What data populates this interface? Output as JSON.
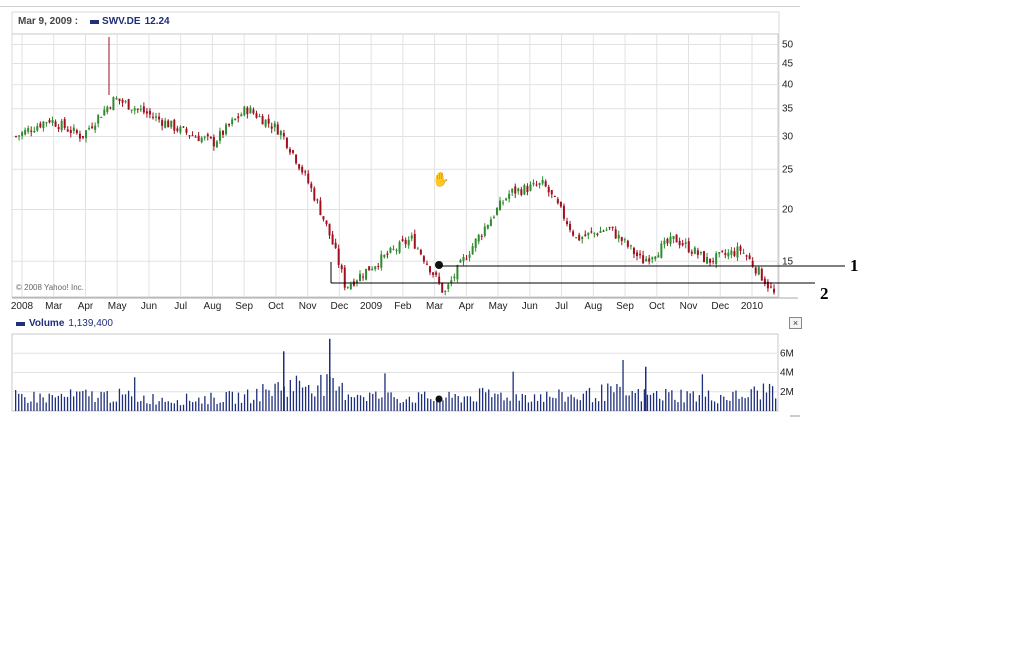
{
  "header": {
    "date": "Mar 9, 2009 :",
    "ticker": "SWV.DE",
    "price": "12.24"
  },
  "copyright": "© 2008 Yahoo! Inc.",
  "volume": {
    "label": "Volume",
    "value": "1,139,400",
    "close_label": "×"
  },
  "annotations": {
    "line1": "1",
    "line2": "2"
  },
  "colors": {
    "up": "#2e8b2e",
    "down": "#a01020",
    "volume": "#1f2f7a",
    "grid": "#e2e2e2"
  },
  "chart_data": {
    "type": "line",
    "style": "candlestick",
    "title": "",
    "log_scale": true,
    "grid": true,
    "ylim": [
      12,
      55
    ],
    "y_ticks": [
      50,
      45,
      40,
      35,
      30,
      25,
      20,
      15
    ],
    "x_ticks": [
      "2008",
      "Mar",
      "Apr",
      "May",
      "Jun",
      "Jul",
      "Aug",
      "Sep",
      "Oct",
      "Nov",
      "Dec",
      "2009",
      "Feb",
      "Mar",
      "Apr",
      "May",
      "Jun",
      "Jul",
      "Aug",
      "Sep",
      "Oct",
      "Nov",
      "Dec",
      "2010"
    ],
    "series": [
      {
        "x": [
          "2008-02",
          "2008-03",
          "2008-04",
          "2008-05",
          "2008-06",
          "2008-07",
          "2008-08",
          "2008-09",
          "2008-10",
          "2008-11",
          "2008-12",
          "2009-01",
          "2009-02",
          "2009-03",
          "2009-04",
          "2009-05",
          "2009-06",
          "2009-07",
          "2009-08",
          "2009-09",
          "2009-10",
          "2009-11",
          "2009-12",
          "2010-01"
        ],
        "values": [
          30,
          33,
          30,
          37,
          34,
          31,
          29,
          35,
          31,
          22,
          13,
          15,
          17,
          12.5,
          17,
          22,
          23,
          17,
          18,
          15,
          17,
          15,
          16,
          12.5
        ]
      }
    ],
    "volume_series": {
      "y_ticks": [
        "6M",
        "4M",
        "2M"
      ],
      "ylim": [
        0,
        8
      ],
      "x": [
        "2008-02",
        "2008-03",
        "2008-04",
        "2008-05",
        "2008-06",
        "2008-07",
        "2008-08",
        "2008-09",
        "2008-10",
        "2008-11",
        "2008-12",
        "2009-01",
        "2009-02",
        "2009-03",
        "2009-04",
        "2009-05",
        "2009-06",
        "2009-07",
        "2009-08",
        "2009-09",
        "2009-10",
        "2009-11",
        "2009-12",
        "2010-01"
      ],
      "values": [
        1.5,
        1.4,
        1.6,
        1.6,
        1.3,
        1.2,
        1.3,
        1.5,
        2.5,
        3.0,
        2.0,
        1.5,
        1.4,
        1.3,
        1.6,
        1.7,
        1.5,
        1.5,
        2.0,
        1.6,
        1.7,
        1.5,
        1.5,
        2.5
      ]
    }
  }
}
